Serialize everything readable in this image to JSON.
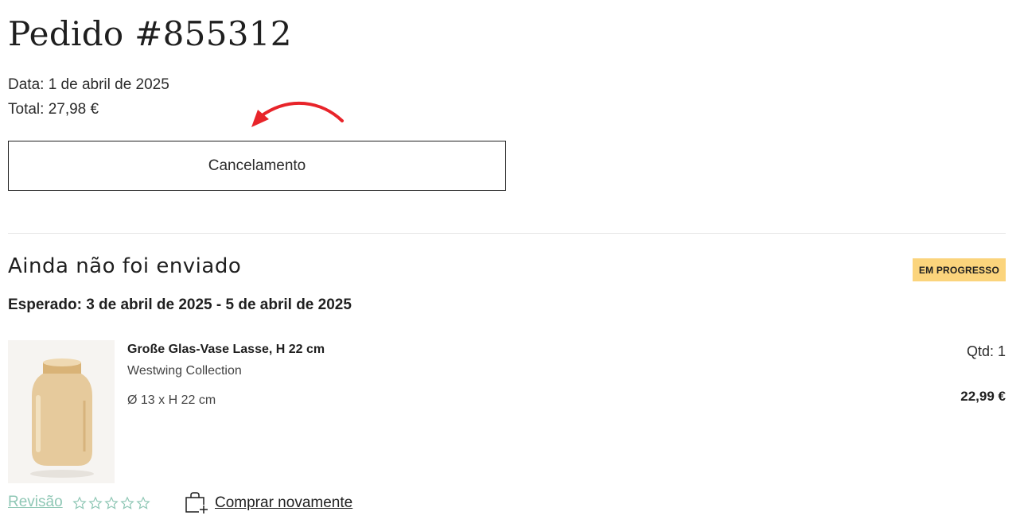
{
  "order": {
    "title": "Pedido #855312",
    "date": "Data: 1 de abril de 2025",
    "total": "Total: 27,98 €",
    "cancel_label": "Cancelamento"
  },
  "shipment": {
    "title": "Ainda não foi enviado",
    "status": "EM PROGRESSO",
    "status_color": "#fbd47c",
    "expected": "Esperado: 3 de abril de 2025 - 5 de abril de 2025"
  },
  "product": {
    "name": "Große Glas-Vase Lasse, H 22 cm",
    "brand": "Westwing Collection",
    "size": "Ø 13 x H 22 cm",
    "qty": "Qtd: 1",
    "price": "22,99 €",
    "image_icon": "amber-glass-vase"
  },
  "actions": {
    "review_label": "Revisão",
    "review_color": "#8fc7b5",
    "rating": 0,
    "rating_max": 5,
    "buy_again_label": "Comprar novamente",
    "buy_again_icon": "bag-plus-icon"
  },
  "annotation": {
    "arrow_color": "#e8242a"
  }
}
